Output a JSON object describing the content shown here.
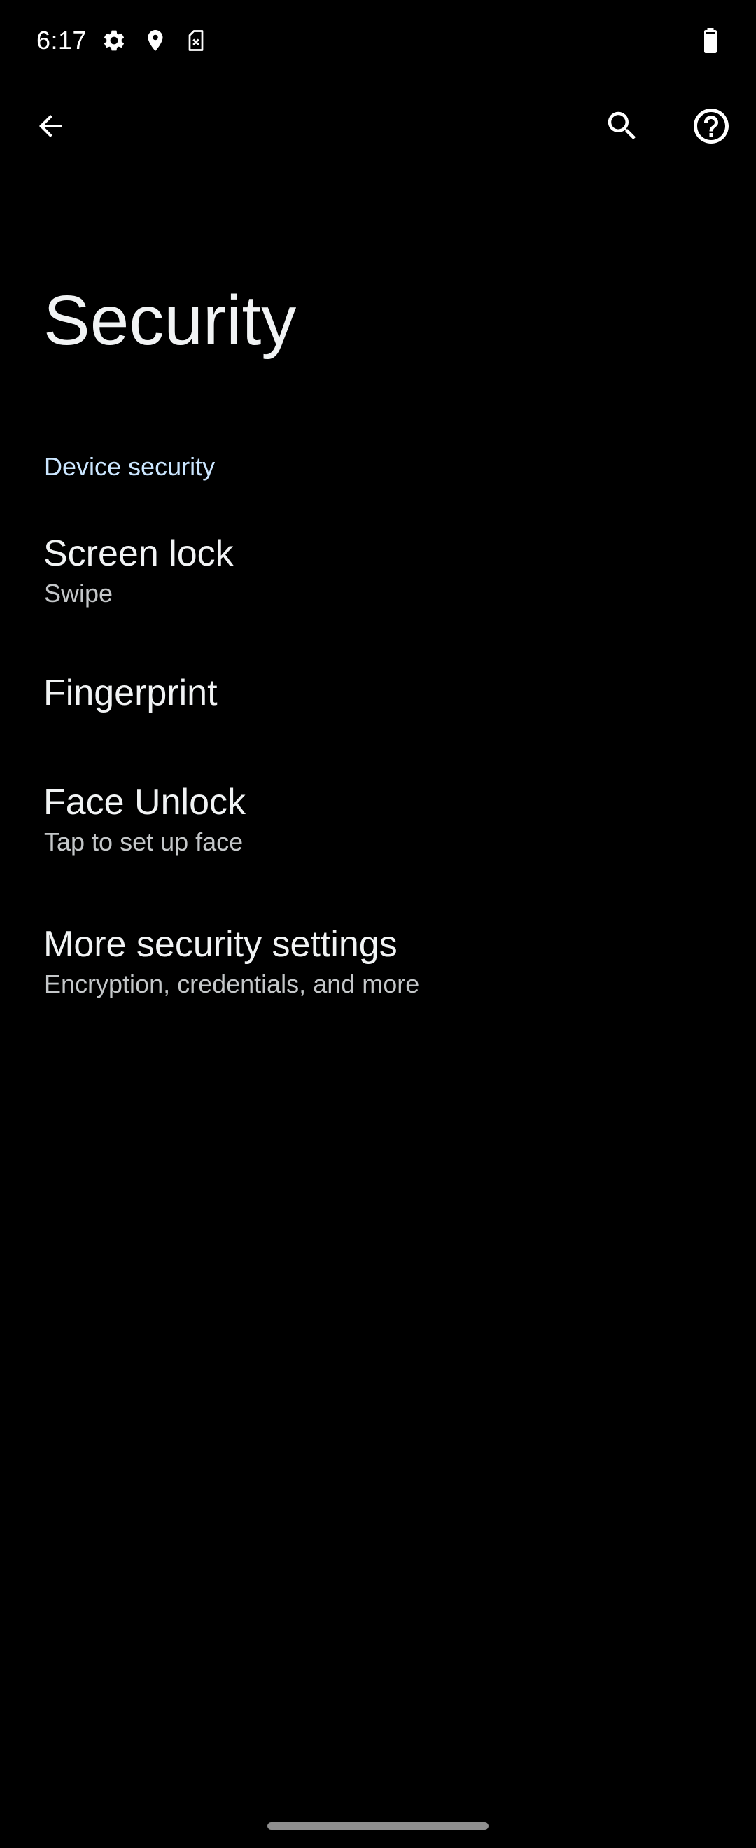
{
  "status_bar": {
    "time": "6:17",
    "icons_left": [
      "gear-icon",
      "location-pin-icon",
      "no-sim-icon"
    ],
    "icons_right": [
      "battery-icon"
    ]
  },
  "app_bar": {
    "back_icon": "arrow-back-icon",
    "search_icon": "search-icon",
    "help_icon": "help-circle-icon"
  },
  "page": {
    "title": "Security"
  },
  "sections": [
    {
      "header": "Device security",
      "items": [
        {
          "title": "Screen lock",
          "summary": "Swipe"
        },
        {
          "title": "Fingerprint",
          "summary": ""
        },
        {
          "title": "Face Unlock",
          "summary": "Tap to set up face"
        },
        {
          "title": "More security settings",
          "summary": "Encryption, credentials, and more"
        }
      ]
    }
  ],
  "colors": {
    "background": "#000000",
    "text_primary": "#f1f3f4",
    "text_secondary": "#c4c7c9",
    "section_accent": "#cbe6ff",
    "nav_handle": "#8f8f8f"
  }
}
